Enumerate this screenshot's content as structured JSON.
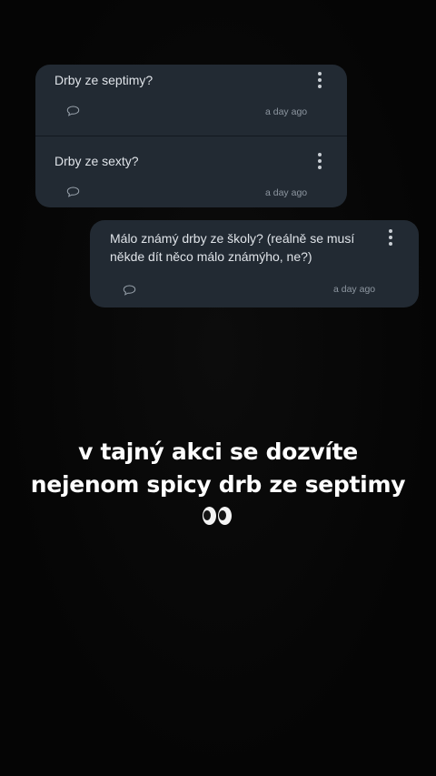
{
  "cards": [
    {
      "question": "Drby ze septimy?",
      "time": "a day ago"
    },
    {
      "question": "Drby ze sexty?",
      "time": "a day ago"
    },
    {
      "question_line1": "Málo známý drby ze školy? (reálně se musí",
      "question_line2": "někde dít něco málo známýho, ne?)",
      "time": "a day ago"
    }
  ],
  "caption": {
    "line1": "v tajný akci se dozvíte",
    "line2": "nejenom spicy drb ze septimy",
    "emoji": "eyes-emoji"
  },
  "icons": {
    "comment": "comment-icon",
    "menu": "more-vertical-icon"
  },
  "colors": {
    "background": "#050505",
    "card": "#222a33",
    "card_text": "#dfe3e8",
    "meta_text": "#8d96a0",
    "caption_text": "#ffffff"
  }
}
